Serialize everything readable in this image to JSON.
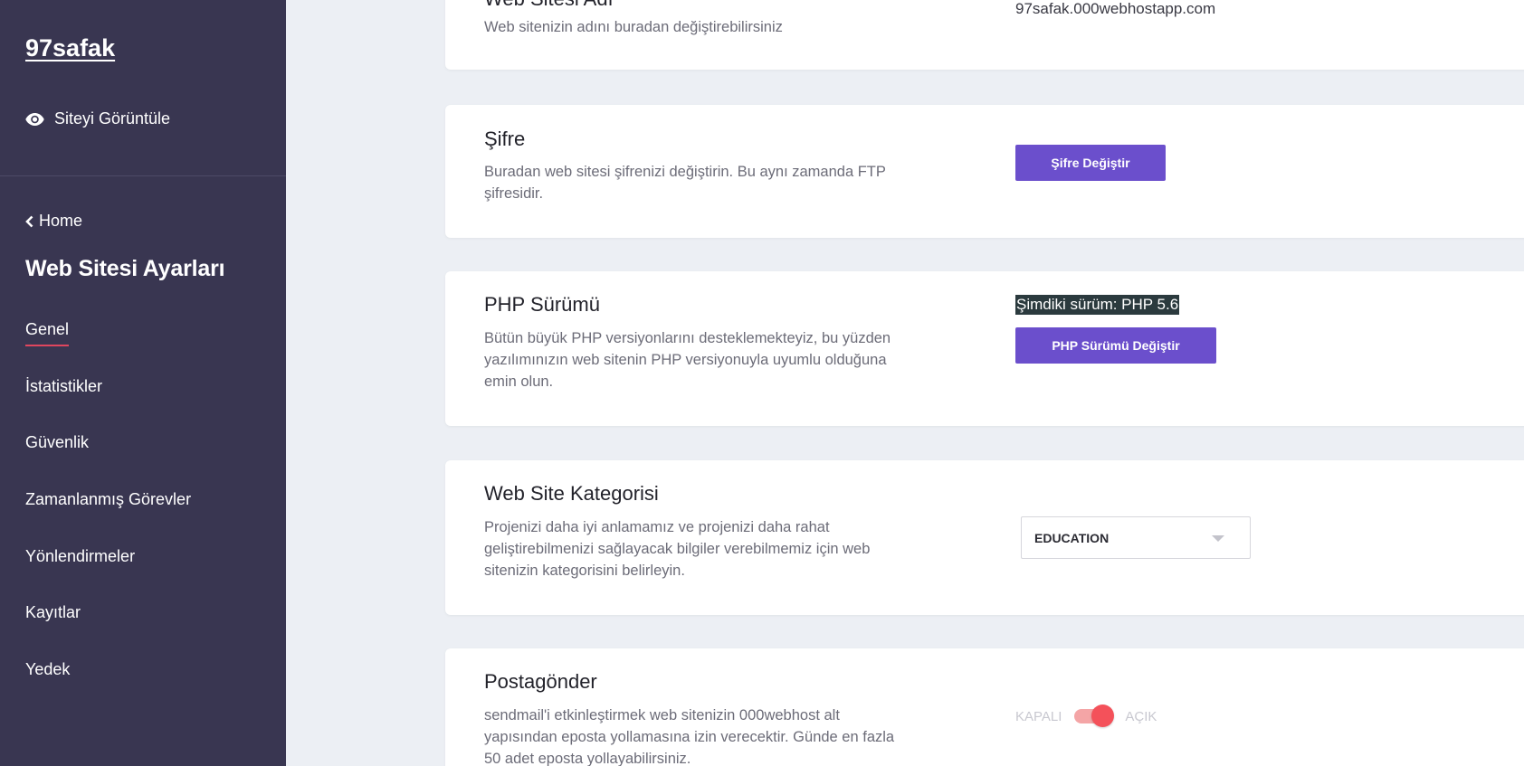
{
  "sidebar": {
    "brand": "97safak",
    "view_site": "Siteyi Görüntüle",
    "back_label": "Home",
    "section_title": "Web Sitesi Ayarları",
    "items": [
      {
        "label": "Genel",
        "active": true
      },
      {
        "label": "İstatistikler"
      },
      {
        "label": "Güvenlik"
      },
      {
        "label": "Zamanlanmış Görevler"
      },
      {
        "label": "Yönlendirmeler"
      },
      {
        "label": "Kayıtlar"
      },
      {
        "label": "Yedek"
      }
    ]
  },
  "cards": {
    "site_name": {
      "title": "Web Sitesi Adı",
      "desc": "Web sitenizin adını buradan değiştirebilirsiniz",
      "value": "97safak.000webhostapp.com"
    },
    "password": {
      "title": "Şifre",
      "desc": "Buradan web sitesi şifrenizi değiştirin. Bu aynı zamanda FTP şifresidir.",
      "button": "Şifre Değiştir"
    },
    "php": {
      "title": "PHP Sürümü",
      "desc": "Bütün büyük PHP versiyonlarını desteklemekteyiz, bu yüzden yazılımınızın web sitenin PHP versiyonuyla uyumlu olduğuna emin olun.",
      "current": "Şimdiki sürüm: PHP 5.6",
      "button": "PHP Sürümü Değiştir"
    },
    "category": {
      "title": "Web Site Kategorisi",
      "desc": "Projenizi daha iyi anlamamız ve projenizi daha rahat geliştirebilmenizi sağlayacak bilgiler verebilmemiz için web sitenizin kategorisini belirleyin.",
      "selected": "EDUCATION"
    },
    "mail": {
      "title": "Postagönder",
      "desc": "sendmail'i etkinleştirmek web sitenizin 000webhost alt yapısından eposta yollamasına izin verecektir. Günde en fazla 50 adet eposta yollayabilirsiniz.",
      "off_label": "KAPALI",
      "on_label": "AÇIK",
      "enabled": true
    }
  },
  "colors": {
    "sidebar_bg": "#393651",
    "accent_button": "#6b4fcc",
    "toggle_on": "#f4515a",
    "active_underline": "#e0465e",
    "page_bg": "#eceff4"
  },
  "icons": [
    "eye-icon",
    "chevron-left-icon",
    "caret-down-icon"
  ]
}
